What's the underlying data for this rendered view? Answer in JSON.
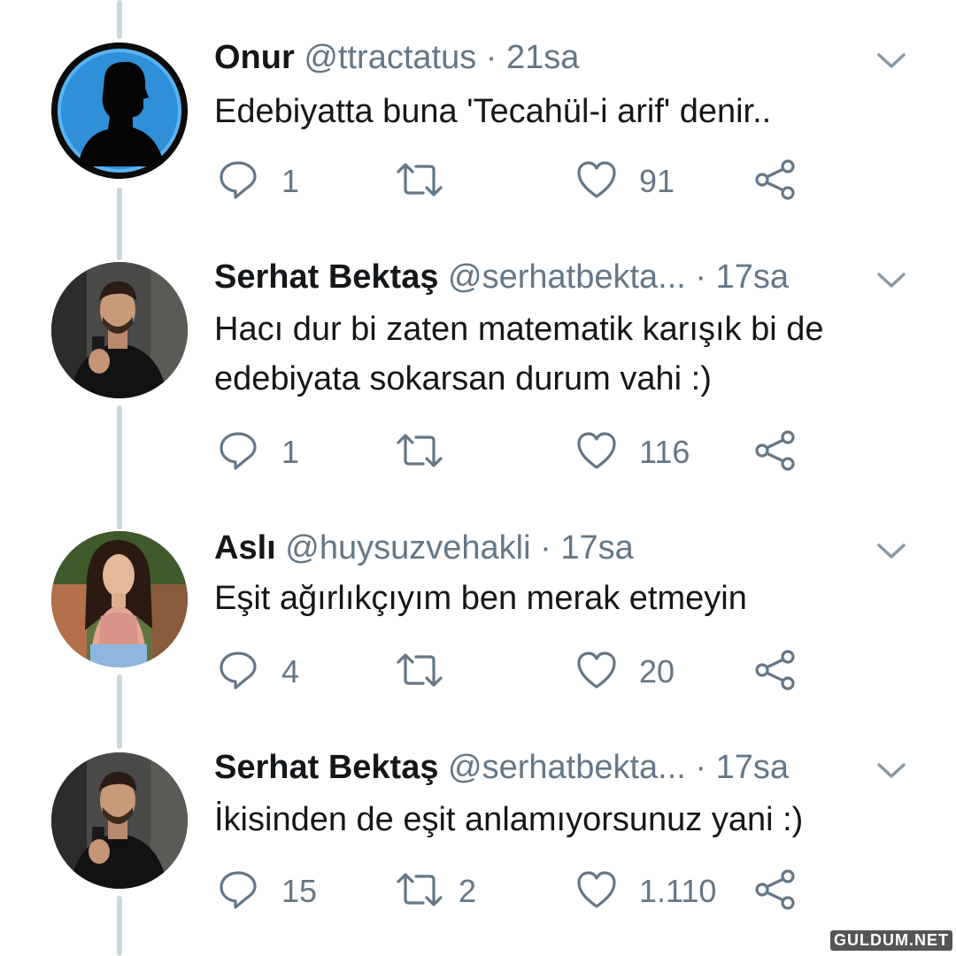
{
  "colors": {
    "thread_line": "#ccd6dd",
    "name": "#14171a",
    "meta": "#657786",
    "icon": "#657786"
  },
  "tweets": [
    {
      "name": "Onur",
      "handle": "@ttractatus",
      "time": "21sa",
      "text": "Edebiyatta buna 'Tecahül-i arif' denir..",
      "replies": "1",
      "retweets": "",
      "likes": "91",
      "avatar": "silhouette"
    },
    {
      "name": "Serhat Bektaş",
      "handle": "@serhatbekta...",
      "time": "17sa",
      "text": "Hacı dur bi zaten matematik karışık bi de edebiyata sokarsan durum vahi :)",
      "replies": "1",
      "retweets": "",
      "likes": "116",
      "avatar": "man-selfie"
    },
    {
      "name": "Aslı",
      "handle": "@huysuzvehakli",
      "time": "17sa",
      "text": "Eşit ağırlıkçıyım ben merak etmeyin",
      "replies": "4",
      "retweets": "",
      "likes": "20",
      "avatar": "woman-photo"
    },
    {
      "name": "Serhat Bektaş",
      "handle": "@serhatbekta...",
      "time": "17sa",
      "text": "İkisinden de eşit anlamıyorsunuz yani :)",
      "replies": "15",
      "retweets": "2",
      "likes": "1.110",
      "avatar": "man-selfie"
    }
  ],
  "watermark": "GULDUM.NET",
  "icons": {
    "reply": "reply-icon",
    "retweet": "retweet-icon",
    "like": "heart-icon",
    "share": "share-icon",
    "more": "chevron-down-icon"
  }
}
